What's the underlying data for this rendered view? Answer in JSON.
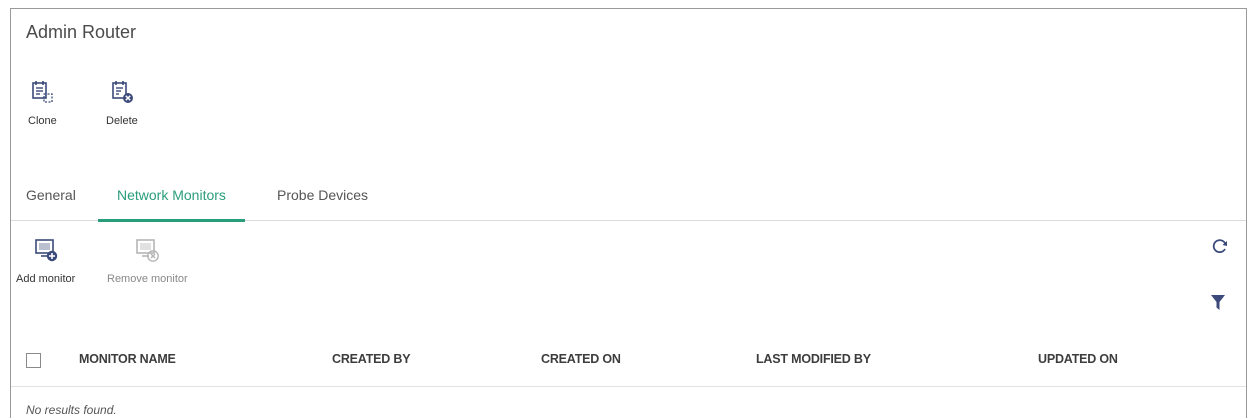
{
  "header": {
    "title": "Admin Router"
  },
  "toolbar": {
    "clone_label": "Clone",
    "delete_label": "Delete"
  },
  "tabs": [
    {
      "label": "General",
      "active": false
    },
    {
      "label": "Network Monitors",
      "active": true
    },
    {
      "label": "Probe Devices",
      "active": false
    }
  ],
  "monitor_toolbar": {
    "add_label": "Add monitor",
    "remove_label": "Remove monitor",
    "remove_disabled": true
  },
  "side_actions": {
    "refresh_icon": "refresh-icon",
    "filter_icon": "filter-icon"
  },
  "table": {
    "columns": [
      "MONITOR NAME",
      "CREATED BY",
      "CREATED ON",
      "LAST MODIFIED BY",
      "UPDATED ON"
    ],
    "rows": [],
    "empty_text": "No results found."
  },
  "colors": {
    "accent": "#2a9d7a",
    "icon": "#3b4a7a",
    "disabled_icon": "#b5b5b5"
  }
}
